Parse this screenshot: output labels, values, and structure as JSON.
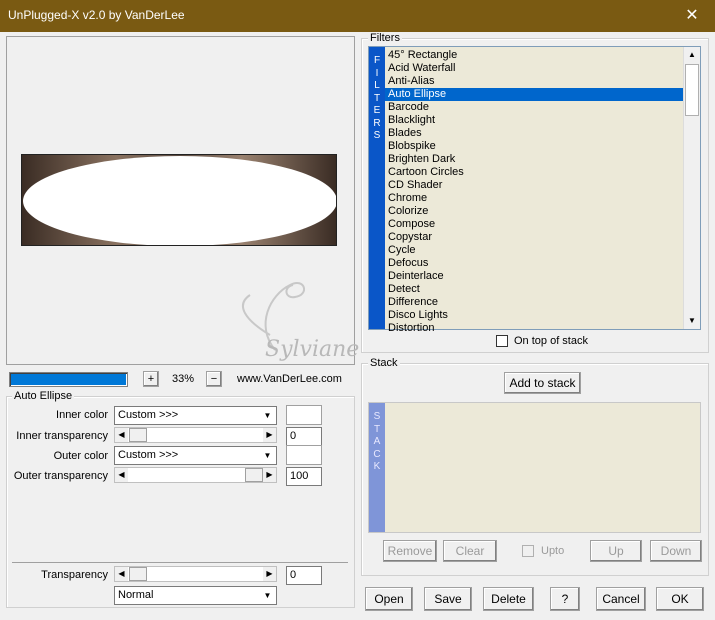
{
  "window": {
    "title": "UnPlugged-X v2.0 by VanDerLee",
    "close_glyph": "✕"
  },
  "preview": {
    "zoom": "33%",
    "zoom_in": "+",
    "zoom_out": "−",
    "website": "www.VanDerLee.com",
    "watermark_text": "Sylviane",
    "progress_fraction": 1.0
  },
  "filters": {
    "group_label": "Filters",
    "strip_letters": [
      "F",
      "I",
      "L",
      "T",
      "E",
      "R",
      "S"
    ],
    "items": [
      "45° Rectangle",
      "Acid Waterfall",
      "Anti-Alias",
      "Auto Ellipse",
      "Barcode",
      "Blacklight",
      "Blades",
      "Blobspike",
      "Brighten Dark",
      "Cartoon Circles",
      "CD Shader",
      "Chrome",
      "Colorize",
      "Compose",
      "Copystar",
      "Cycle",
      "Defocus",
      "Deinterlace",
      "Detect",
      "Difference",
      "Disco Lights",
      "Distortion"
    ],
    "selected_index": 3,
    "on_top_label": "On top of stack"
  },
  "stack": {
    "group_label": "Stack",
    "add_label": "Add to stack",
    "strip_letters": [
      "S",
      "T",
      "A",
      "C",
      "K"
    ],
    "remove_label": "Remove",
    "clear_label": "Clear",
    "upto_label": "Upto",
    "up_label": "Up",
    "down_label": "Down"
  },
  "params": {
    "group_label": "Auto Ellipse",
    "inner_color_label": "Inner color",
    "inner_color_value": "Custom >>>",
    "inner_transparency_label": "Inner transparency",
    "inner_transparency_value": "0",
    "outer_color_label": "Outer color",
    "outer_color_value": "Custom >>>",
    "outer_transparency_label": "Outer transparency",
    "outer_transparency_value": "100"
  },
  "bottom": {
    "transparency_label": "Transparency",
    "transparency_value": "0",
    "blend_mode": "Normal"
  },
  "footer": {
    "open": "Open",
    "save": "Save",
    "delete": "Delete",
    "help": "?",
    "cancel": "Cancel",
    "ok": "OK"
  },
  "colors": {
    "titlebar": "#7a5a12",
    "accent": "#0066cc",
    "list_bg": "#ece9d8"
  }
}
